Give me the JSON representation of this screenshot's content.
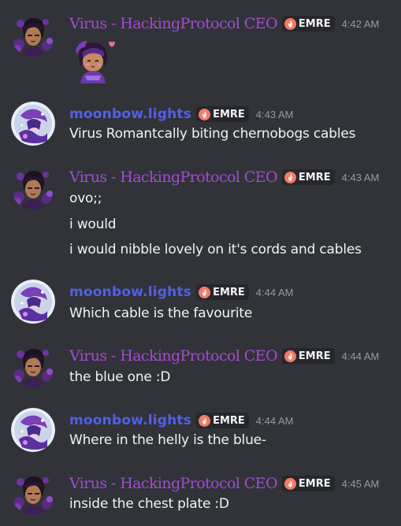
{
  "colors": {
    "background": "#313338",
    "virus_name": "#a24bd1",
    "moonbow_name": "#5160e8",
    "timestamp": "#949ba4",
    "message_text": "#f2f3f5",
    "tag_bg": "#26272c"
  },
  "users": {
    "virus": "Virus - HackingProtocol CEO",
    "moonbow": "moonbow.lights"
  },
  "tag_label": "EMRE",
  "tag_icon": "flame-heart-icon",
  "messages": [
    {
      "author": "Virus - HackingProtocol CEO",
      "time": "4:42 AM",
      "lines": [],
      "sticker": "chibi-character-sticker"
    },
    {
      "author": "moonbow.lights",
      "time": "4:43 AM",
      "lines": [
        "Virus Romantcally biting chernobogs cables"
      ]
    },
    {
      "author": "Virus - HackingProtocol CEO",
      "time": "4:43 AM",
      "lines": [
        "ovo;;",
        "i would",
        "i would nibble lovely on it's cords and cables"
      ]
    },
    {
      "author": "moonbow.lights",
      "time": "4:44 AM",
      "lines": [
        "Which cable is the favourite"
      ]
    },
    {
      "author": "Virus - HackingProtocol CEO",
      "time": "4:44 AM",
      "lines": [
        "the blue one :D"
      ]
    },
    {
      "author": "moonbow.lights",
      "time": "4:44 AM",
      "lines": [
        "Where in the helly is the blue-"
      ]
    },
    {
      "author": "Virus - HackingProtocol CEO",
      "time": "4:45 AM",
      "lines": [
        "inside the chest plate :D"
      ]
    }
  ]
}
